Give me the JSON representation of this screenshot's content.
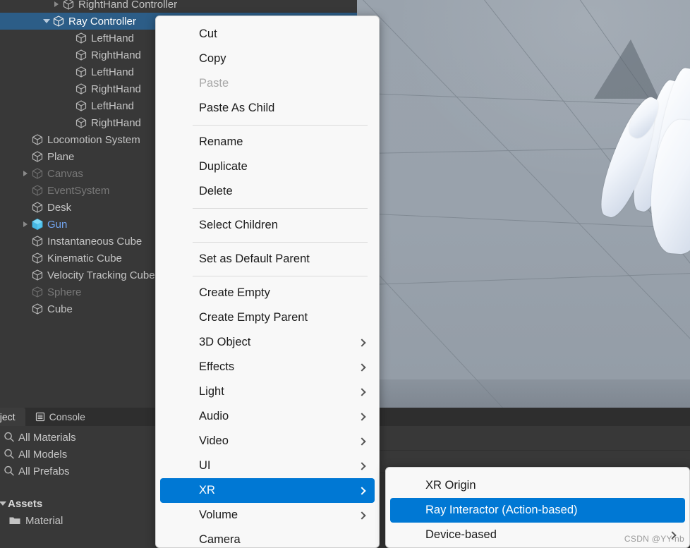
{
  "hierarchy": {
    "rows": [
      {
        "label": "RightHand Controller",
        "indent": 88,
        "twisty": "right",
        "state": "normal",
        "clipped": true
      },
      {
        "label": "Ray Controller",
        "indent": 74,
        "twisty": "down",
        "state": "selected"
      },
      {
        "label": "LeftHand",
        "indent": 106,
        "twisty": "none",
        "state": "normal"
      },
      {
        "label": "RightHand",
        "indent": 106,
        "twisty": "none",
        "state": "normal"
      },
      {
        "label": "LeftHand",
        "indent": 106,
        "twisty": "none",
        "state": "normal"
      },
      {
        "label": "RightHand",
        "indent": 106,
        "twisty": "none",
        "state": "normal"
      },
      {
        "label": "LeftHand",
        "indent": 106,
        "twisty": "none",
        "state": "normal"
      },
      {
        "label": "RightHand",
        "indent": 106,
        "twisty": "none",
        "state": "normal"
      },
      {
        "label": "Locomotion System",
        "indent": 44,
        "twisty": "none",
        "state": "normal"
      },
      {
        "label": "Plane",
        "indent": 44,
        "twisty": "none",
        "state": "normal"
      },
      {
        "label": "Canvas",
        "indent": 44,
        "twisty": "right",
        "state": "dim"
      },
      {
        "label": "EventSystem",
        "indent": 44,
        "twisty": "none",
        "state": "dim"
      },
      {
        "label": "Desk",
        "indent": 44,
        "twisty": "none",
        "state": "normal"
      },
      {
        "label": "Gun",
        "indent": 44,
        "twisty": "right",
        "state": "prefab"
      },
      {
        "label": "Instantaneous Cube",
        "indent": 44,
        "twisty": "none",
        "state": "normal"
      },
      {
        "label": "Kinematic Cube",
        "indent": 44,
        "twisty": "none",
        "state": "normal"
      },
      {
        "label": "Velocity Tracking Cube",
        "indent": 44,
        "twisty": "none",
        "state": "normal"
      },
      {
        "label": "Sphere",
        "indent": 44,
        "twisty": "none",
        "state": "dim"
      },
      {
        "label": "Cube",
        "indent": 44,
        "twisty": "none",
        "state": "normal"
      }
    ]
  },
  "project": {
    "tabs": [
      {
        "label": "Project",
        "icon": "project-icon",
        "active": true
      },
      {
        "label": "Console",
        "icon": "console-icon",
        "active": false
      }
    ],
    "searches": [
      {
        "label": "All Materials",
        "icon": "search-icon"
      },
      {
        "label": "All Models",
        "icon": "search-icon"
      },
      {
        "label": "All Prefabs",
        "icon": "search-icon"
      }
    ],
    "assets": [
      {
        "label": "Assets",
        "icon": "twisty-down-icon",
        "bold": true
      },
      {
        "label": "Material",
        "icon": "folder-icon",
        "bold": false
      }
    ]
  },
  "context_menu": {
    "items": [
      {
        "label": "Cut",
        "type": "item",
        "state": "normal"
      },
      {
        "label": "Copy",
        "type": "item",
        "state": "normal"
      },
      {
        "label": "Paste",
        "type": "item",
        "state": "disabled"
      },
      {
        "label": "Paste As Child",
        "type": "item",
        "state": "normal"
      },
      {
        "label": "",
        "type": "separator"
      },
      {
        "label": "Rename",
        "type": "item",
        "state": "normal"
      },
      {
        "label": "Duplicate",
        "type": "item",
        "state": "normal"
      },
      {
        "label": "Delete",
        "type": "item",
        "state": "normal"
      },
      {
        "label": "",
        "type": "separator"
      },
      {
        "label": "Select Children",
        "type": "item",
        "state": "normal"
      },
      {
        "label": "",
        "type": "separator"
      },
      {
        "label": "Set as Default Parent",
        "type": "item",
        "state": "normal"
      },
      {
        "label": "",
        "type": "separator"
      },
      {
        "label": "Create Empty",
        "type": "item",
        "state": "normal"
      },
      {
        "label": "Create Empty Parent",
        "type": "item",
        "state": "normal"
      },
      {
        "label": "3D Object",
        "type": "item",
        "state": "normal",
        "submenu": true
      },
      {
        "label": "Effects",
        "type": "item",
        "state": "normal",
        "submenu": true
      },
      {
        "label": "Light",
        "type": "item",
        "state": "normal",
        "submenu": true
      },
      {
        "label": "Audio",
        "type": "item",
        "state": "normal",
        "submenu": true
      },
      {
        "label": "Video",
        "type": "item",
        "state": "normal",
        "submenu": true
      },
      {
        "label": "UI",
        "type": "item",
        "state": "normal",
        "submenu": true
      },
      {
        "label": "XR",
        "type": "item",
        "state": "highlight",
        "submenu": true
      },
      {
        "label": "Volume",
        "type": "item",
        "state": "normal",
        "submenu": true
      },
      {
        "label": "Camera",
        "type": "item",
        "state": "normal"
      }
    ]
  },
  "submenu": {
    "items": [
      {
        "label": "XR Origin",
        "state": "normal"
      },
      {
        "label": "Ray Interactor (Action-based)",
        "state": "highlight"
      },
      {
        "label": "Device-based",
        "state": "normal",
        "submenu": true
      }
    ]
  },
  "watermark": {
    "text": "CSDN @YY-nb"
  },
  "colors": {
    "selection_blue": "#2c5d87",
    "menu_highlight": "#0078d4",
    "prefab_blue": "#72a5f0",
    "panel_bg": "#383838",
    "menu_bg": "#f8f8f8",
    "scene_bg": "#9aa3ad",
    "red_object": "#f23c32"
  }
}
